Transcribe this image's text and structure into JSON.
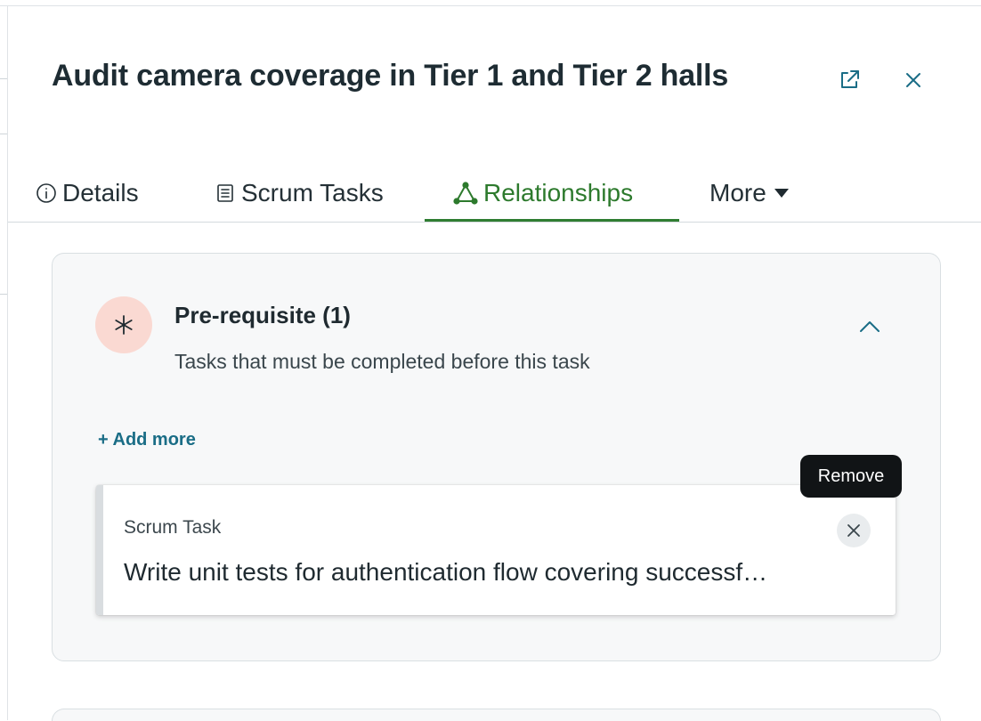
{
  "panel": {
    "title": "Audit camera coverage in Tier 1 and Tier 2 halls",
    "open_in_new_icon": "external-link-icon",
    "close_icon": "close-icon"
  },
  "tabs": [
    {
      "label": "Details",
      "icon": "info-circle-icon",
      "active": false
    },
    {
      "label": "Scrum Tasks",
      "icon": "list-document-icon",
      "active": false
    },
    {
      "label": "Relationships",
      "icon": "triangle-nodes-icon",
      "active": true
    },
    {
      "label": "More",
      "icon": "caret-down-icon",
      "active": false
    }
  ],
  "prerequisite": {
    "title": "Pre-requisite (1)",
    "description": "Tasks that must be completed before this task",
    "badge_icon": "asterisk-icon",
    "collapse_icon": "chevron-up-icon",
    "add_more_label": "+ Add more",
    "items": [
      {
        "type": "Scrum Task",
        "title": "Write unit tests for authentication flow covering successf…",
        "remove_icon": "close-icon"
      }
    ],
    "tooltip": "Remove"
  },
  "colors": {
    "accent_green": "#2f7d32",
    "link_teal": "#1a6d86",
    "badge_pink": "#fad9d2",
    "tooltip_bg": "#111416"
  }
}
